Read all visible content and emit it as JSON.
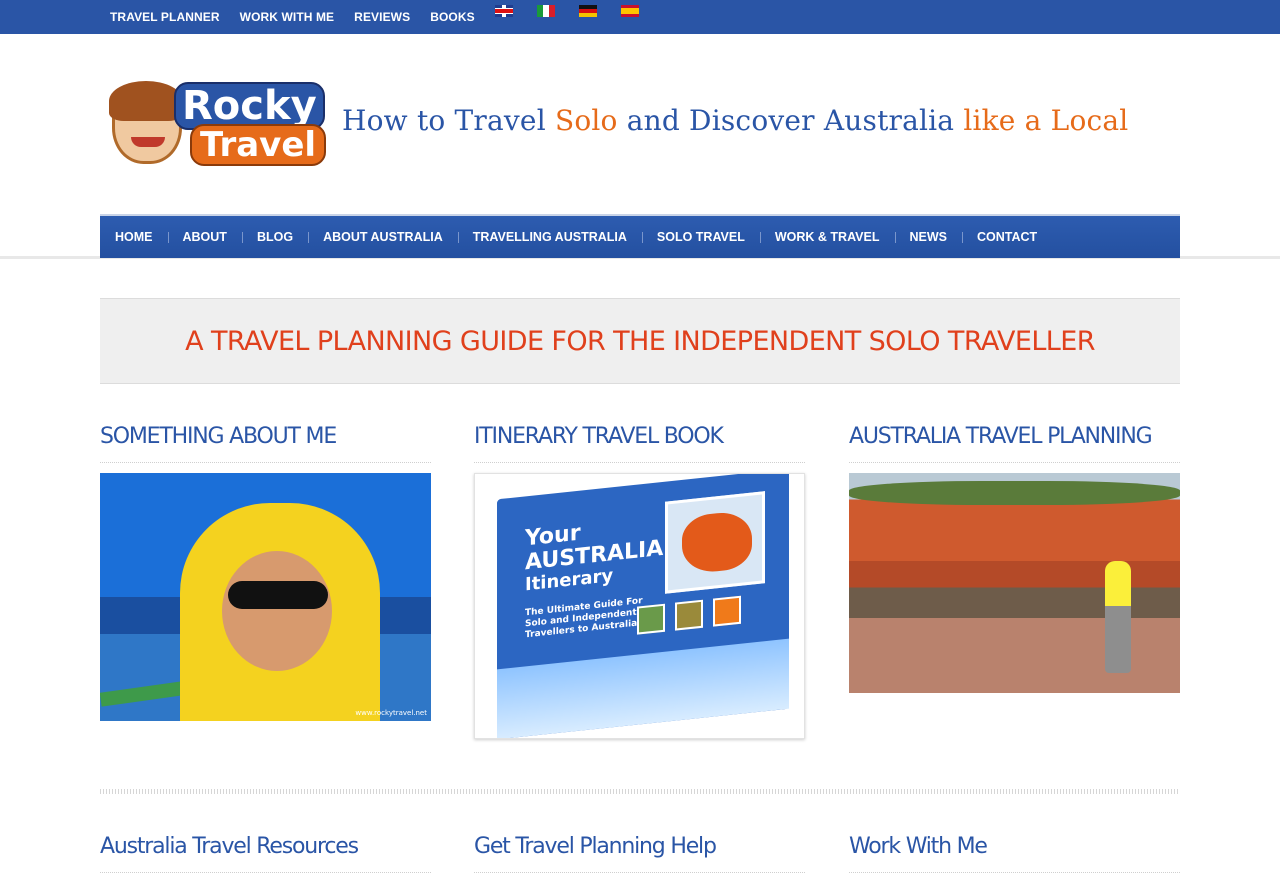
{
  "topbar": {
    "links": [
      "TRAVEL PLANNER",
      "WORK WITH ME",
      "REVIEWS",
      "BOOKS"
    ],
    "flags": [
      "english-flag-icon",
      "italian-flag-icon",
      "german-flag-icon",
      "spanish-flag-icon"
    ]
  },
  "header": {
    "logo_line1": "Rocky",
    "logo_line2": "Travel",
    "tagline_part1": "How to Travel ",
    "tagline_part2": "Solo",
    "tagline_part3": " and Discover Australia ",
    "tagline_part4": "like a Local"
  },
  "nav": {
    "items": [
      "HOME",
      "ABOUT",
      "BLOG",
      "ABOUT AUSTRALIA",
      "TRAVELLING AUSTRALIA",
      "SOLO TRAVEL",
      "WORK & TRAVEL",
      "NEWS",
      "CONTACT"
    ]
  },
  "banner": {
    "title": "A TRAVEL PLANNING GUIDE FOR THE INDEPENDENT SOLO TRAVELLER"
  },
  "columns": [
    {
      "title": "SOMETHING ABOUT ME",
      "image": "portrait-photo"
    },
    {
      "title": "ITINERARY TRAVEL BOOK",
      "image": "book-cover-photo"
    },
    {
      "title": "AUSTRALIA TRAVEL PLANNING",
      "image": "coast-photo"
    }
  ],
  "book": {
    "title_line1": "Your",
    "title_line2": "AUSTRALIA",
    "title_line3": "Itinerary",
    "subtitle": "The Ultimate Guide For Solo and Independent Travellers to Australia"
  },
  "photo_watermark": "www.rockytravel.net",
  "footer_columns": [
    "Australia Travel Resources",
    "Get Travel Planning Help",
    "Work With Me"
  ],
  "colors": {
    "brand_blue": "#2a55a6",
    "accent_orange": "#e66b1a",
    "banner_red": "#e0401c"
  }
}
